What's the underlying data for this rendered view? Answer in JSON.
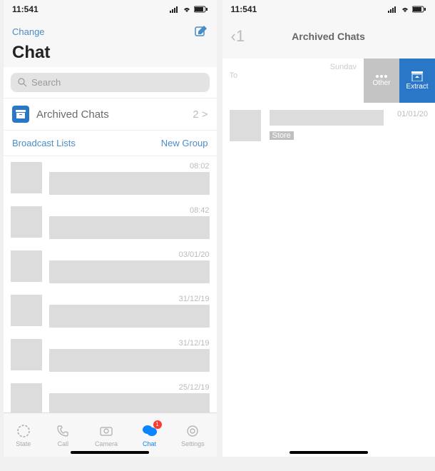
{
  "left": {
    "status_time": "11:541",
    "header": {
      "change": "Change",
      "title": "Chat"
    },
    "search_placeholder": "Search",
    "archived": {
      "label": "Archived Chats",
      "count": "2 >"
    },
    "broadcast": "Broadcast Lists",
    "new_group": "New Group",
    "chats": [
      {
        "time": "08:02"
      },
      {
        "time": "08:42"
      },
      {
        "time": "03/01/20"
      },
      {
        "time": "31/12/19"
      },
      {
        "time": "31/12/19"
      },
      {
        "time": "25/12/19"
      }
    ],
    "tabs": {
      "state": "State",
      "call": "Call",
      "camera": "Camera",
      "chat": "Chat",
      "settings": "Settings",
      "badge": "1"
    }
  },
  "right": {
    "status_time": "11:541",
    "title": "Archived Chats",
    "swipe": {
      "to": "To",
      "day": "Sundav",
      "other": "Other",
      "extract": "Extract"
    },
    "item": {
      "date": "01/01/20",
      "store": "Store"
    }
  }
}
